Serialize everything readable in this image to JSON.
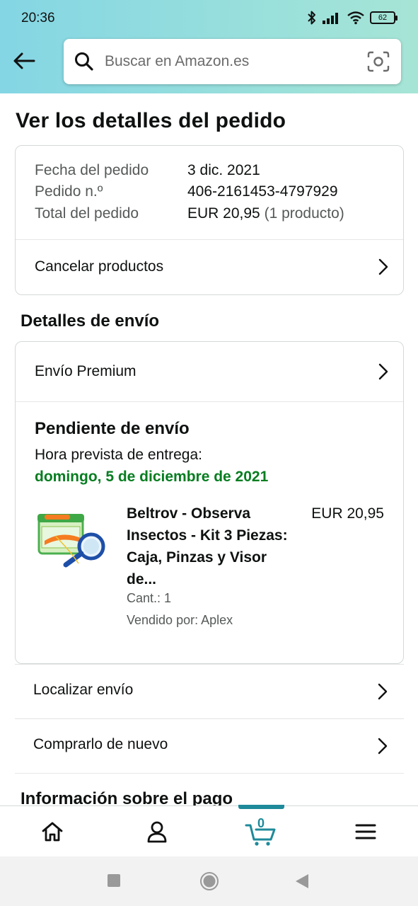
{
  "status_bar": {
    "time": "20:36",
    "battery": "62"
  },
  "search": {
    "placeholder": "Buscar en Amazon.es"
  },
  "page": {
    "title": "Ver los detalles del pedido"
  },
  "summary": {
    "rows": [
      {
        "label": "Fecha del pedido",
        "value": "3 dic. 2021",
        "extra": ""
      },
      {
        "label": "Pedido n.º",
        "value": "406-2161453-4797929",
        "extra": ""
      },
      {
        "label": "Total del pedido",
        "value": "EUR 20,95",
        "extra": "(1 producto)"
      }
    ],
    "cancel_label": "Cancelar productos"
  },
  "shipping": {
    "section_title": "Detalles de envío",
    "method": "Envío Premium",
    "status": "Pendiente de envío",
    "eta_label": "Hora prevista de entrega:",
    "eta_date": "domingo, 5 de diciembre de 2021",
    "eta_color": "#067d20",
    "product": {
      "title_lines": [
        "Beltrov - Observa",
        "Insectos - Kit 3 Piezas:",
        "Caja, Pinzas y Visor",
        "de..."
      ],
      "price": "EUR 20,95",
      "quantity": "Cant.: 1",
      "seller": "Vendido por: Aplex"
    }
  },
  "actions": [
    {
      "label": "Localizar envío"
    },
    {
      "label": "Comprarlo de nuevo"
    }
  ],
  "payment": {
    "section_title": "Información sobre el pago"
  },
  "bottom_nav": {
    "items": [
      "home-icon",
      "account-icon",
      "cart-icon",
      "menu-icon"
    ],
    "cart_count": "0",
    "accent": "#1e8a9a"
  }
}
